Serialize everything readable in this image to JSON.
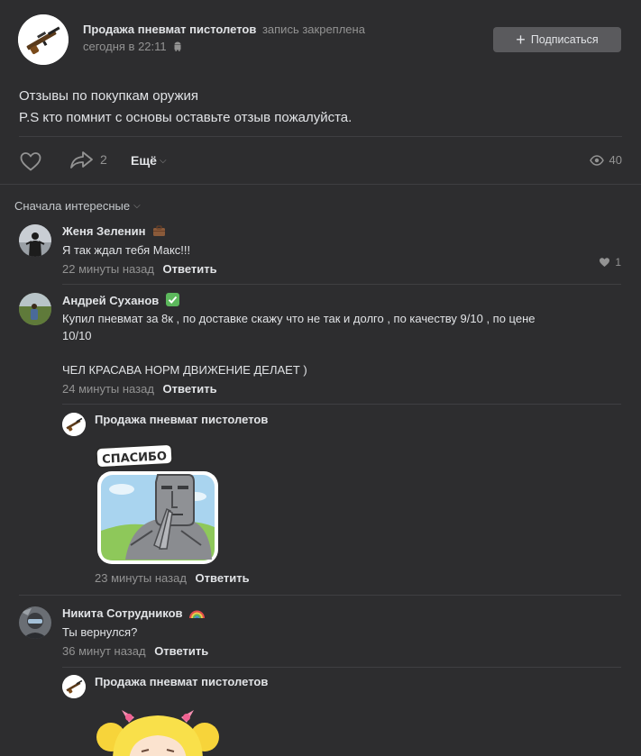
{
  "post": {
    "group_name": "Продажа пневмат пистолетов",
    "pinned_label": "запись закреплена",
    "date": "сегодня в 22:11",
    "subscribe_label": "Подписаться",
    "text_line1": "Отзывы по покупкам оружия",
    "text_line2": "P.S кто помнит с основы оставьте отзыв пожалуйста.",
    "share_count": "2",
    "more_label": "Ещё",
    "views_count": "40"
  },
  "comments_header": {
    "sort_label": "Сначала интересные"
  },
  "comments": [
    {
      "author": "Женя Зеленин",
      "text": "Я так ждал тебя Макс!!!",
      "time": "22 минуты назад",
      "reply_label": "Ответить",
      "likes": "1"
    },
    {
      "author": "Андрей Суханов",
      "text_line1": "Купил пневмат за 8к , по доставке скажу что не так и долго , по качеству 9/10 , по цене",
      "text_line2": "10/10",
      "text_line3": "ЧЕЛ КРАСАВА НОРМ ДВИЖЕНИЕ ДЕЛАЕТ )",
      "time": "24 минуты назад",
      "reply_label": "Ответить"
    },
    {
      "author": "Никита Сотрудников",
      "text": "Ты вернулся?",
      "time": "36 минут назад",
      "reply_label": "Ответить"
    }
  ],
  "replies": [
    {
      "author": "Продажа пневмат пистолетов",
      "sticker_text": "СПАСИБО",
      "time": "23 минуты назад",
      "reply_label": "Ответить"
    },
    {
      "author": "Продажа пневмат пистолетов"
    }
  ],
  "colors": {
    "background": "#2d2d2f",
    "text_primary": "#e1e3e6",
    "text_secondary": "#939393",
    "button_bg": "#5a5a5d",
    "divider": "#3f3f42"
  }
}
